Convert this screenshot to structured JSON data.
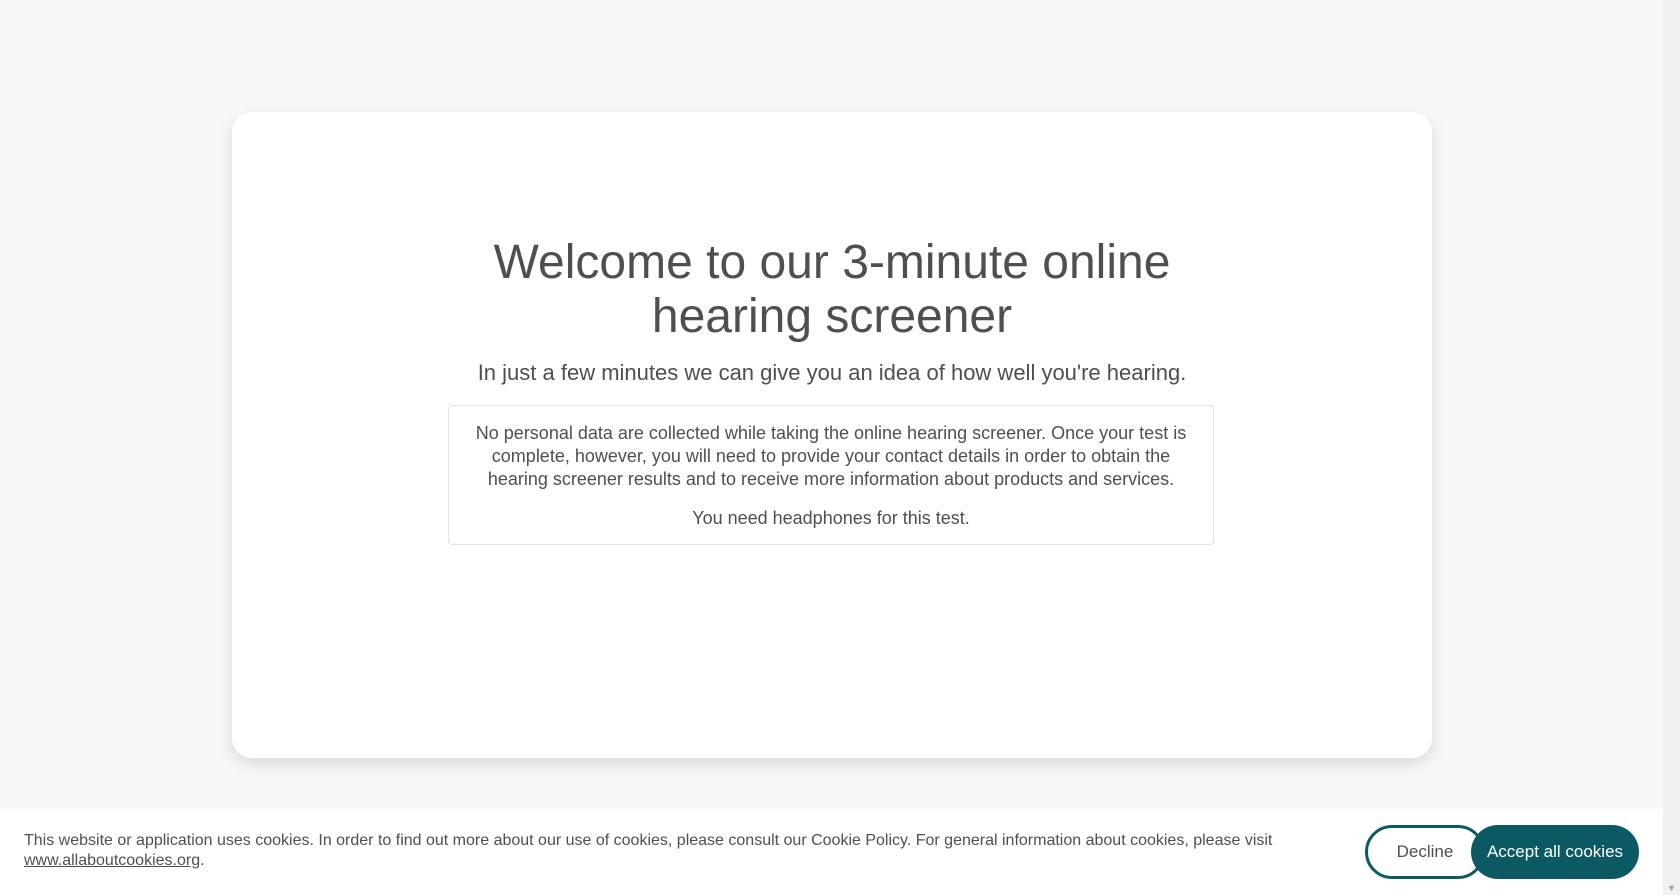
{
  "main": {
    "title": "Welcome to our 3-minute online hearing screener",
    "subtitle": "In just a few minutes we can give you an idea of how well you're hearing.",
    "info": {
      "privacy_text": "No personal data are collected while taking the online hearing screener. Once your test is complete, however, you will need to provide your contact details in order to obtain the hearing screener results and to receive more information about products and services.",
      "headphones_text": "You need headphones for this test."
    }
  },
  "cookie_banner": {
    "text": "This website or application uses cookies. In order to find out more about our use of cookies, please consult our Cookie Policy. For general information about cookies, please visit",
    "link_text": "www.allaboutcookies.org",
    "trailing": ".",
    "decline_label": "Decline",
    "accept_label": "Accept all cookies"
  },
  "colors": {
    "accent": "#0b5a63",
    "page_background": "#f7f8f9",
    "text": "#4f4f4f"
  }
}
